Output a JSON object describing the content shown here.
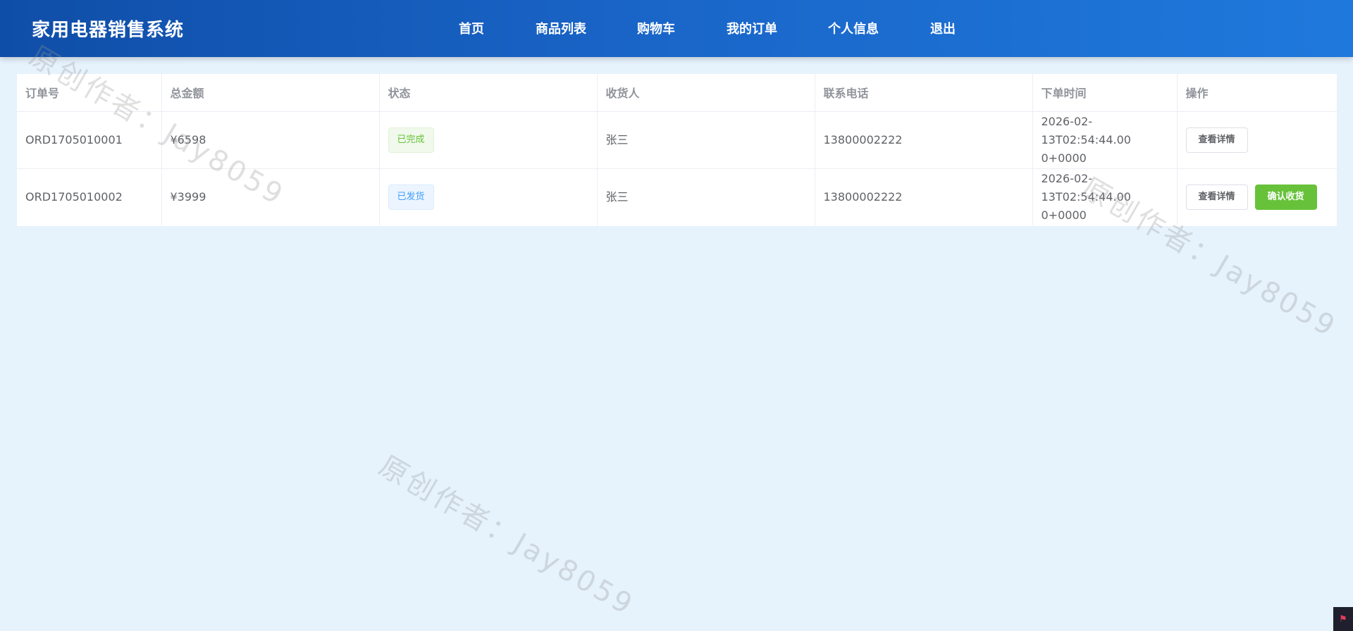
{
  "header": {
    "app_title": "家用电器销售系统",
    "nav": [
      {
        "label": "首页"
      },
      {
        "label": "商品列表"
      },
      {
        "label": "购物车"
      },
      {
        "label": "我的订单"
      },
      {
        "label": "个人信息"
      },
      {
        "label": "退出"
      }
    ]
  },
  "orders_table": {
    "columns": [
      "订单号",
      "总金额",
      "状态",
      "收货人",
      "联系电话",
      "下单时间",
      "操作"
    ],
    "rows": [
      {
        "order_no": "ORD1705010001",
        "amount": "¥6598",
        "status": "已完成",
        "receiver": "张三",
        "phone": "13800002222",
        "time_line1": "2026-02-13T02:54:44.00",
        "time_line2": "0+0000",
        "view_label": "查看详情"
      },
      {
        "order_no": "ORD1705010002",
        "amount": "¥3999",
        "status": "已发货",
        "receiver": "张三",
        "phone": "13800002222",
        "time_line1": "2026-02-13T02:54:44.00",
        "time_line2": "0+0000",
        "view_label": "查看详情",
        "confirm_label": "确认收货"
      }
    ]
  },
  "watermark": {
    "text": "原创作者：Jay8059"
  },
  "colors": {
    "header_start": "#0f4ea8",
    "header_end": "#1f79dc",
    "page_bg": "#e6f2fc",
    "success": "#67c23a",
    "primary": "#409eff"
  },
  "icons": {
    "corner": "flag-icon"
  }
}
